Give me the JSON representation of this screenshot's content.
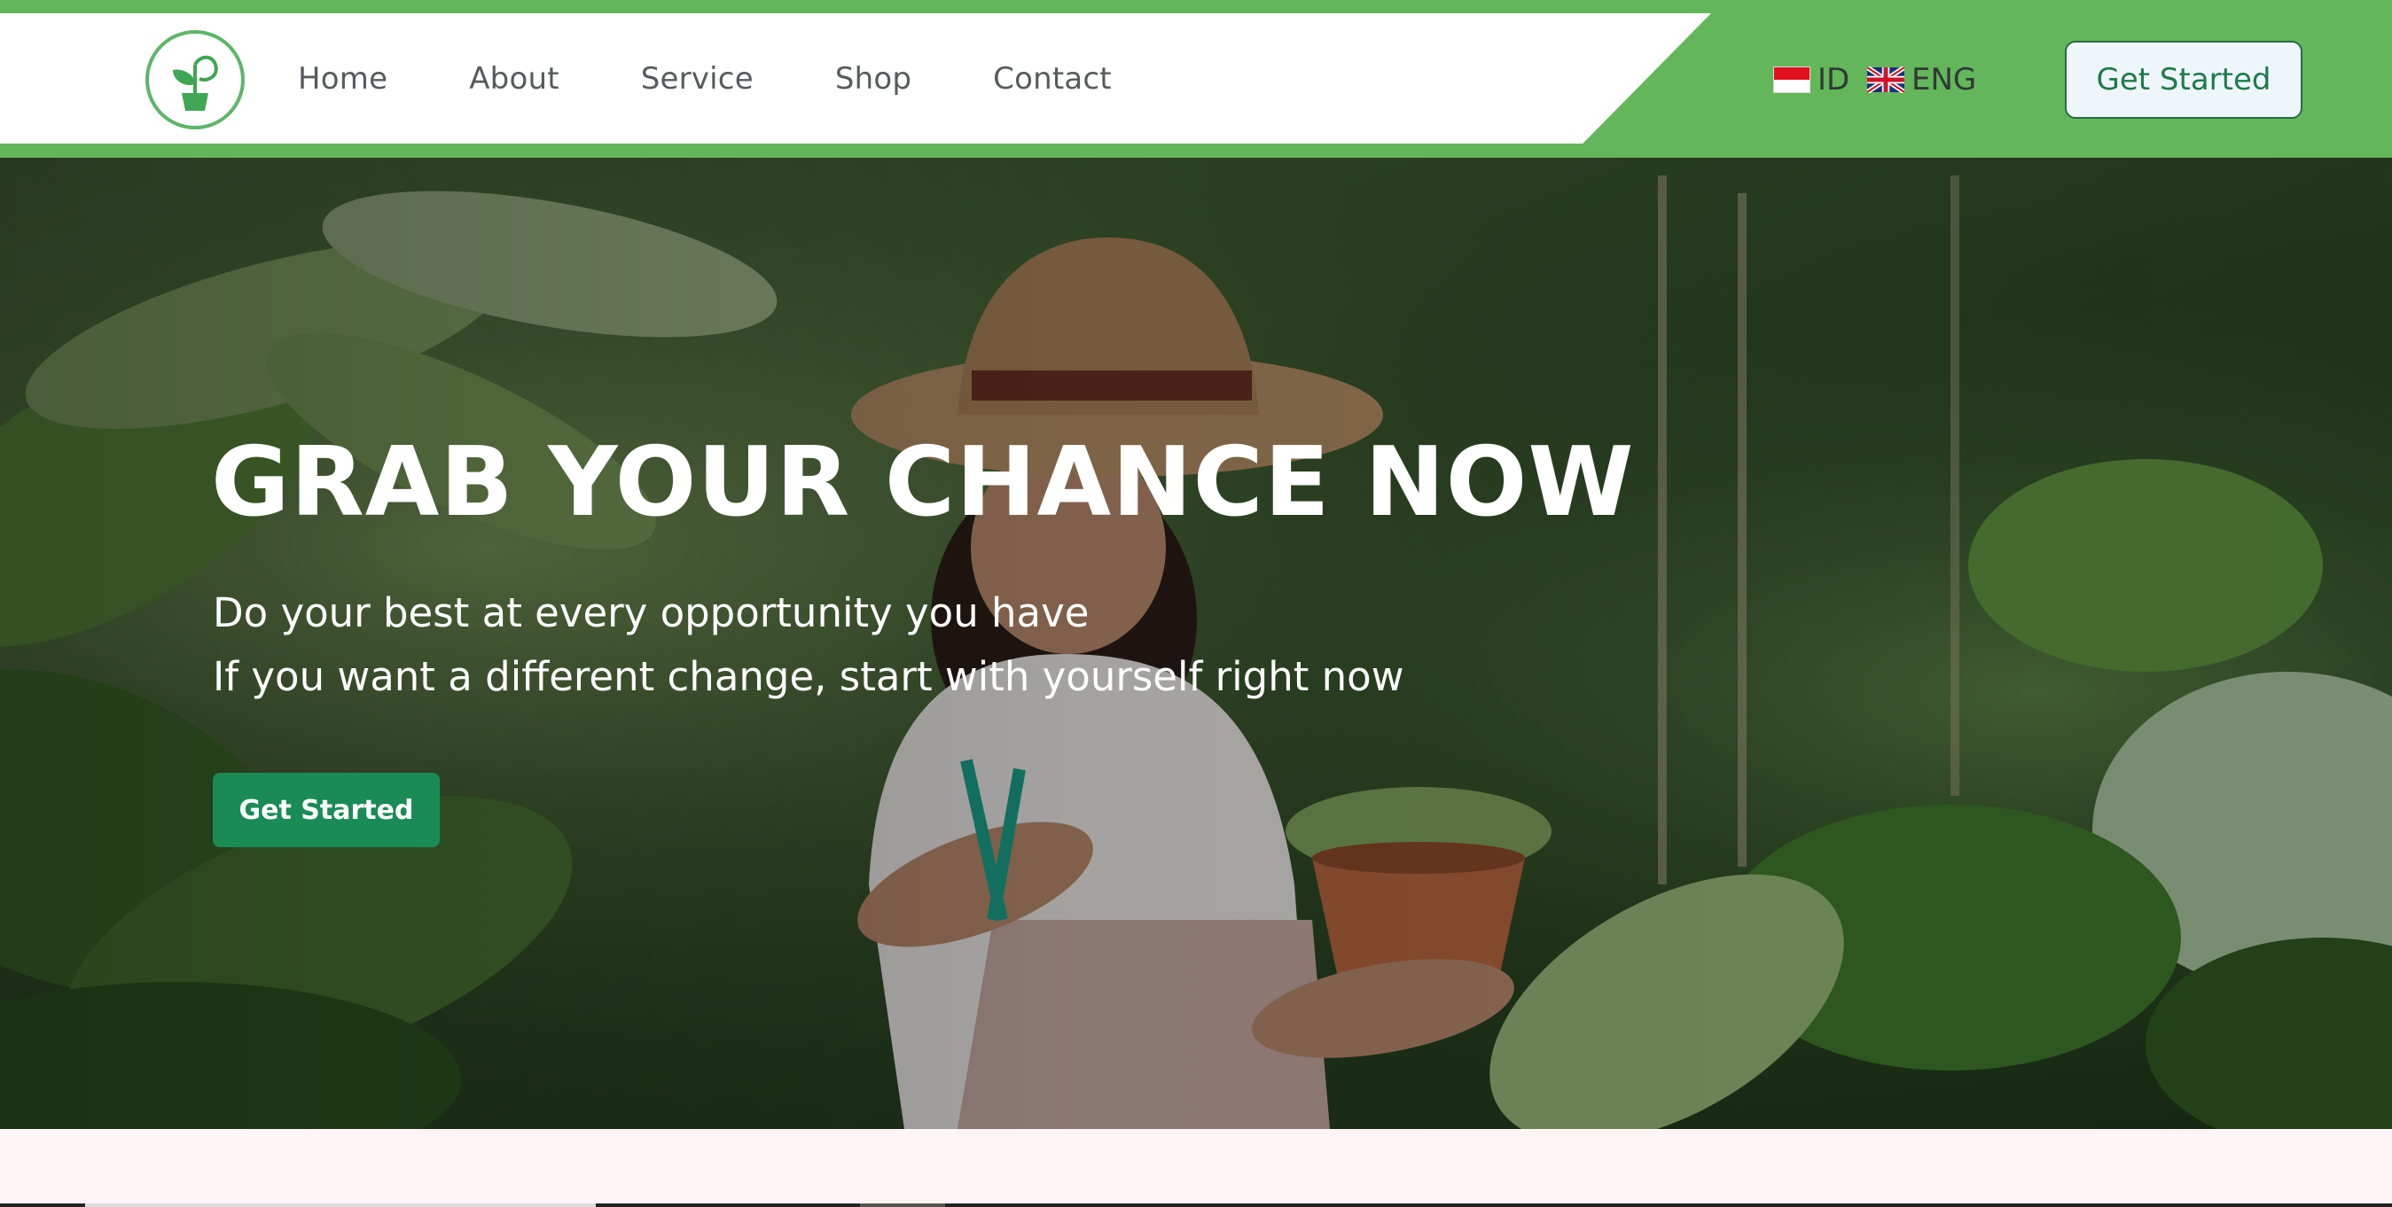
{
  "nav": {
    "links": [
      "Home",
      "About",
      "Service",
      "Shop",
      "Contact"
    ],
    "languages": [
      {
        "code_label": "ID",
        "flag": "indonesia-flag-icon"
      },
      {
        "code_label": "ENG",
        "flag": "uk-flag-icon"
      }
    ],
    "cta_label": "Get Started",
    "logo_icon": "plant-pot-logo-icon",
    "colors": {
      "brand_green": "#63b65a",
      "cta_text": "#1f7a4c"
    }
  },
  "hero": {
    "title": "GRAB YOUR CHANCE NOW",
    "subtitle_line1": "Do your best at every opportunity you have",
    "subtitle_line2": "If you want a different change, start with yourself right now",
    "cta_label": "Get Started",
    "background": "woman-with-hat-holding-potted-plant-photo",
    "colors": {
      "cta_bg": "#1a8b55"
    }
  }
}
